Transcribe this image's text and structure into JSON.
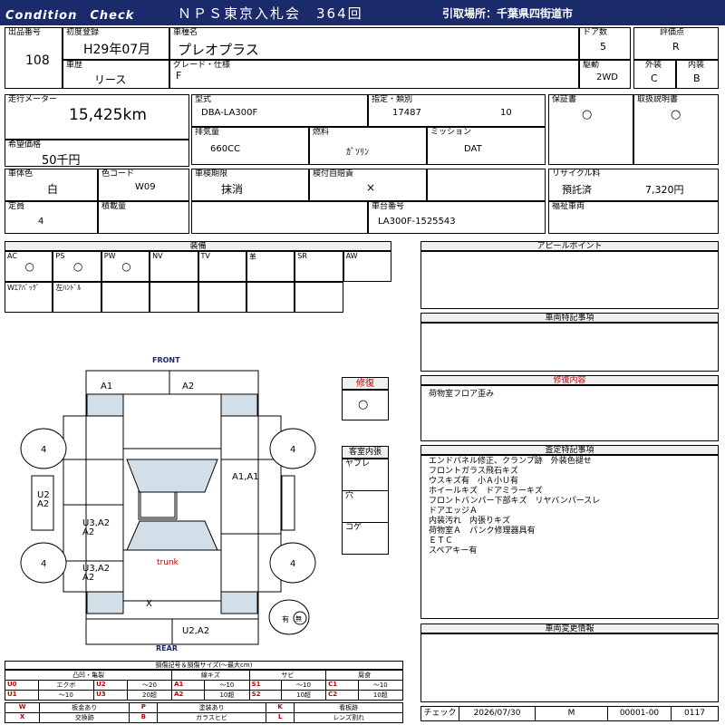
{
  "header": {
    "title": "Condition　Check",
    "auction": "ＮＰＳ東京入札会　364回",
    "pickup": "引取場所：千葉県四街道市"
  },
  "info": {
    "lot_label": "出品番号",
    "lot": "108",
    "reg_label": "初度登録",
    "reg": "H29年07月",
    "name_label": "車種名",
    "name": "プレオプラス",
    "doors_label": "ドア数",
    "doors": "5",
    "score_label": "評価点",
    "score": "R",
    "history_label": "車歴",
    "history": "リース",
    "grade_label": "グレード・仕様",
    "grade": "F",
    "drive_label": "駆動",
    "drive": "2WD",
    "ext_label": "外装",
    "ext": "C",
    "int_label": "内装",
    "int": "B",
    "mileage_label": "走行メーター",
    "mileage": "15,425km",
    "model_label": "型式",
    "model": "DBA-LA300F",
    "cat_label": "指定・類別",
    "cat1": "17487",
    "cat2": "10",
    "warranty_label": "保証書",
    "warranty": "○",
    "manual_label": "取扱説明書",
    "manual": "○",
    "price_label": "希望価格",
    "price": "50千円",
    "cc_label": "排気量",
    "cc": "660CC",
    "fuel_label": "燃料",
    "fuel": "ｶﾞｿﾘﾝ",
    "mission_label": "ミッション",
    "mission": "DAT",
    "color_label": "車体色",
    "color": "白",
    "ccode_label": "色コード",
    "ccode": "W09",
    "inspect_label": "車検期限",
    "inspect": "抹消",
    "ins_label": "検付自賠責",
    "ins": "×",
    "recycle_label": "リサイクル料",
    "recycle_status": "預託済",
    "recycle_amount": "7,320円",
    "cap_label": "定員",
    "cap": "4",
    "load_label": "積載量",
    "chassis_label": "車台番号",
    "chassis": "LA300F-1525543",
    "welfare_label": "福祉車両"
  },
  "equipment": {
    "title": "装備",
    "row1": [
      {
        "k": "AC",
        "v": "○"
      },
      {
        "k": "PS",
        "v": "○"
      },
      {
        "k": "PW",
        "v": "○"
      },
      {
        "k": "NV",
        "v": ""
      },
      {
        "k": "TV",
        "v": ""
      },
      {
        "k": "革",
        "v": ""
      },
      {
        "k": "SR",
        "v": ""
      },
      {
        "k": "AW",
        "v": ""
      }
    ],
    "row2": [
      "Wｴｱﾊﾞｯｸﾞ",
      "左ﾊﾝﾄﾞﾙ"
    ]
  },
  "sections": {
    "appeal": "アピールポイント",
    "notes": "車両特記事項",
    "repair_content": "修復内容",
    "inspection": "査定特記事項",
    "changes": "車両変更情報"
  },
  "repair_content_text": "荷物室フロア歪み",
  "inspection_items": [
    "エンドパネル修正、クランプ跡　外装色褪せ",
    "フロントガラス飛石キズ",
    "ウスキズ有　小Ａ小Ｕ有",
    "ホイールキズ　ドアミラーキズ",
    "フロントバンパー下部キズ　リヤバンパースレ",
    "ドアエッジＡ",
    "内装汚れ　内張りキズ",
    "荷物室Ａ　パンク修理器具有",
    "ＥＴＣ",
    "スペアキー有"
  ],
  "repair": {
    "label": "修復",
    "value": "○"
  },
  "interior": {
    "label": "客室内張",
    "items": [
      "ヤブレ",
      "穴",
      "コゲ"
    ]
  },
  "diagram": {
    "front": "FRONT",
    "rear": "REAR",
    "trunk": "trunk",
    "tire": "4",
    "a1_left": "A1",
    "a2_top": "A2",
    "a1a1": "A1,A1",
    "u2a2_l1": "U2",
    "u2a2_l2": "A2",
    "u3a2_1a": "U3,A2",
    "u3a2_1b": "A2",
    "u3a2_2a": "U3,A2",
    "u3a2_2b": "A2",
    "x": "X",
    "u2a2_rear": "U2,A2",
    "spare_label": "有",
    "spare_mark": "無"
  },
  "legend": {
    "title": "損傷記号＆損傷サイズ(～最大cm)",
    "groups": [
      "凸凹・亀裂",
      "線キズ",
      "サビ",
      "腐食"
    ],
    "rows": [
      [
        "U0",
        "エクボ",
        "U2",
        "～20",
        "A1",
        "～10",
        "S1",
        "～10",
        "C1",
        "～10"
      ],
      [
        "U1",
        "～10",
        "U3",
        "20超",
        "A2",
        "10超",
        "S2",
        "10超",
        "C2",
        "10超"
      ]
    ],
    "extra": [
      [
        "W",
        "板金あり",
        "P",
        "塗装あり",
        "K",
        "看板跡"
      ],
      [
        "X",
        "交換跡",
        "B",
        "ガラスヒビ",
        "L",
        "レンズ割れ"
      ]
    ]
  },
  "footer": {
    "check_label": "チェック",
    "date": "2026/07/30",
    "mark": "M",
    "code": "00001-00",
    "num": "0117"
  },
  "colors": {
    "header": "#1b2a6b",
    "red": "#c00000",
    "panel": "#d2dfe9"
  }
}
